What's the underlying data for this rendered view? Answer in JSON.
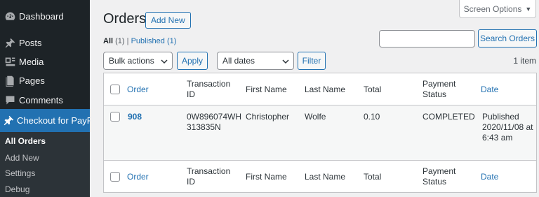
{
  "sidebar": {
    "items": [
      {
        "label": "Dashboard",
        "icon": "dashboard-icon"
      },
      {
        "label": "Posts",
        "icon": "pin-icon"
      },
      {
        "label": "Media",
        "icon": "media-icon"
      },
      {
        "label": "Pages",
        "icon": "pages-icon"
      },
      {
        "label": "Comments",
        "icon": "comments-icon"
      },
      {
        "label": "Checkout for PayPal",
        "icon": "pin-icon"
      }
    ],
    "submenu": [
      "All Orders",
      "Add New",
      "Settings",
      "Debug"
    ]
  },
  "header": {
    "screen_options": "Screen Options",
    "title": "Orders",
    "add_new": "Add New"
  },
  "filters": {
    "all_label": "All",
    "all_count": "(1)",
    "separator": "|",
    "published_label": "Published",
    "published_count": "(1)"
  },
  "search": {
    "placeholder": "",
    "button": "Search Orders"
  },
  "tablenav": {
    "bulk_actions": "Bulk actions",
    "apply": "Apply",
    "dates": "All dates",
    "filter": "Filter",
    "items_count": "1 item"
  },
  "table": {
    "columns": {
      "order": "Order",
      "transaction_id_1": "Transaction",
      "transaction_id_2": "ID",
      "first_name": "First Name",
      "last_name": "Last Name",
      "total": "Total",
      "payment_status_1": "Payment",
      "payment_status_2": "Status",
      "date": "Date"
    },
    "rows": [
      {
        "order": "908",
        "transaction_id_1": "0W896074WH",
        "transaction_id_2": "313835N",
        "first_name": "Christopher",
        "last_name": "Wolfe",
        "total": "0.10",
        "payment_status": "COMPLETED",
        "date_1": "Published",
        "date_2": "2020/11/08 at",
        "date_3": "6:43 am"
      }
    ]
  },
  "colors": {
    "accent": "#2271b1",
    "sidebar_bg": "#1d2327",
    "active_bg": "#2271b1"
  }
}
